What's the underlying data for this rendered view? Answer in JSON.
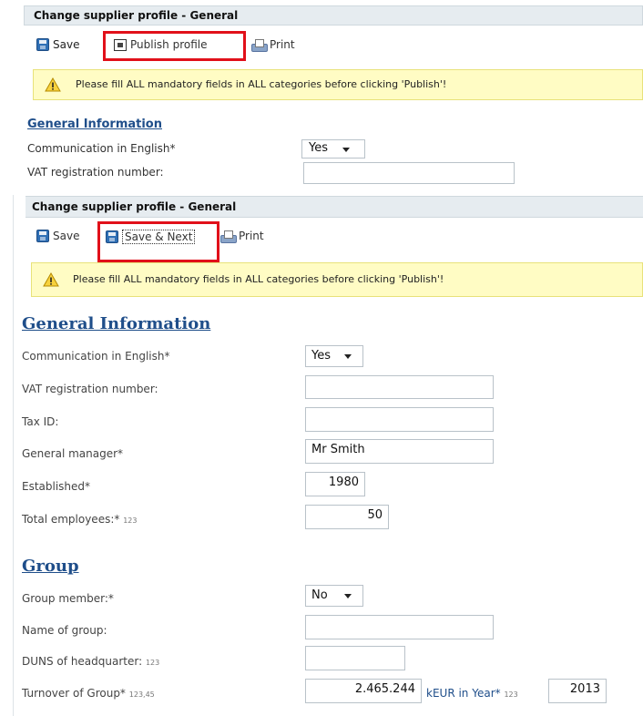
{
  "top_panel": {
    "title": "Change supplier profile - General",
    "toolbar": {
      "save_label": "Save",
      "publish_label": "Publish profile",
      "print_label": "Print"
    },
    "warning": "Please fill ALL mandatory fields in ALL categories before clicking 'Publish'!",
    "section_title": "General Information",
    "fields": {
      "communication_label": "Communication in English*",
      "communication_value": "Yes",
      "vat_label": "VAT registration number:"
    }
  },
  "bottom_panel": {
    "title": "Change supplier profile - General",
    "toolbar": {
      "save_label": "Save",
      "save_next_label": "Save & Next",
      "print_label": "Print"
    },
    "warning": "Please fill ALL mandatory fields in ALL categories before clicking 'Publish'!",
    "general_section_title": "General Information",
    "general_fields": {
      "communication_label": "Communication in English*",
      "communication_value": "Yes",
      "vat_label": "VAT registration number:",
      "tax_label": "Tax ID:",
      "manager_label": "General manager*",
      "manager_value": "Mr Smith",
      "established_label": "Established*",
      "established_value": "1980",
      "employees_label": "Total employees:*",
      "employees_hint": "123",
      "employees_value": "50"
    },
    "group_section_title": "Group",
    "group_fields": {
      "member_label": "Group member:*",
      "member_value": "No",
      "name_label": "Name of group:",
      "duns_label": "DUNS of headquarter:",
      "duns_hint": "123",
      "turnover_label": "Turnover of Group*",
      "turnover_hint": "123,45",
      "turnover_value": "2.465.244",
      "turnover_unit": "kEUR in Year*",
      "year_hint": "123",
      "year_value": "2013"
    }
  },
  "colors": {
    "highlight": "#e1101a",
    "section_title": "#1f4e8a",
    "warning_bg": "#fffcc4",
    "header_bg": "#e6ecf0"
  }
}
